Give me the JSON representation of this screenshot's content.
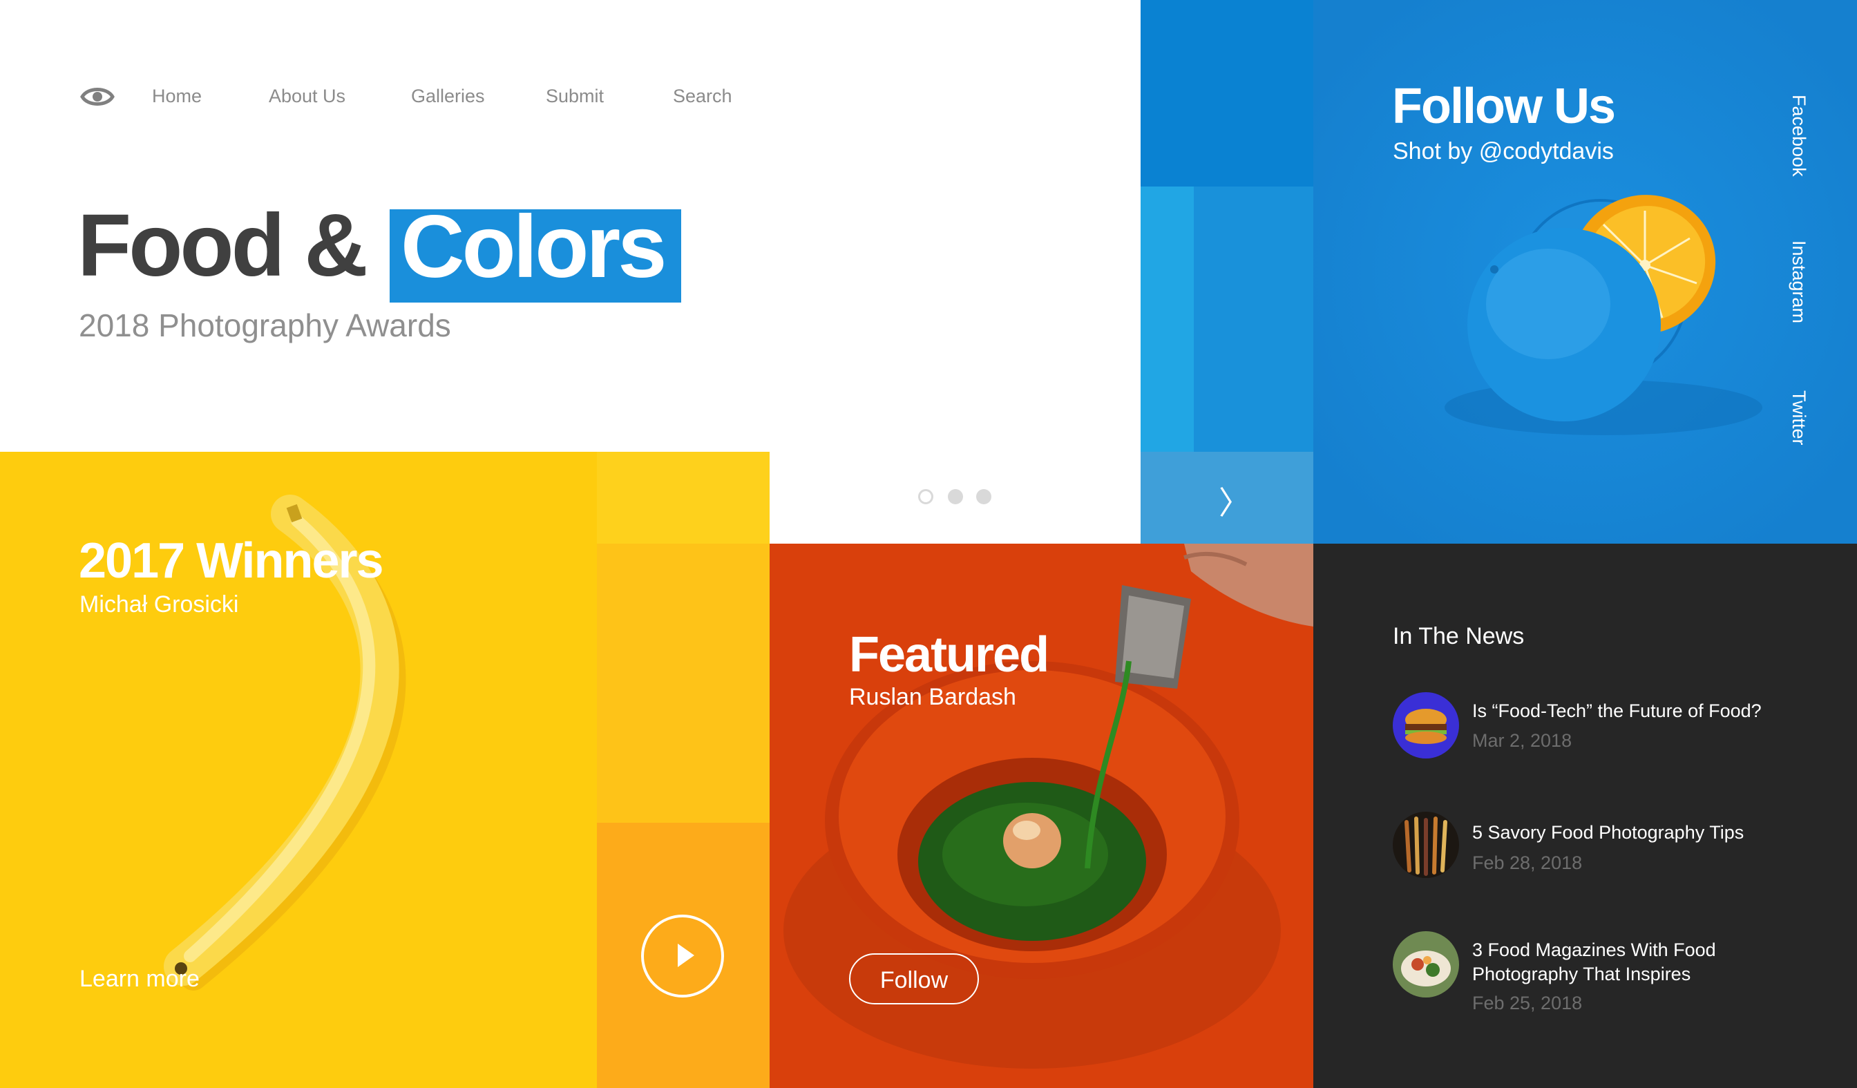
{
  "nav": {
    "items": [
      {
        "label": "Home"
      },
      {
        "label": "About Us"
      },
      {
        "label": "Galleries"
      },
      {
        "label": "Submit"
      },
      {
        "label": "Search"
      }
    ]
  },
  "hero": {
    "title_part1": "Food &",
    "title_part2": "Colors",
    "subtitle": "2018 Photography Awards"
  },
  "follow": {
    "title": "Follow Us",
    "subtitle": "Shot by @codytdavis",
    "social": [
      "Facebook",
      "Instagram",
      "Twitter"
    ],
    "next_glyph": "〉"
  },
  "carousel": {
    "dots": 3,
    "active_index": 0
  },
  "winners": {
    "title": "2017 Winners",
    "subtitle": "Michał Grosicki",
    "link": "Learn more"
  },
  "featured": {
    "title": "Featured",
    "subtitle": "Ruslan Bardash",
    "button": "Follow"
  },
  "news": {
    "heading": "In The News",
    "items": [
      {
        "title": "Is “Food-Tech” the Future of Food?",
        "date": "Mar 2, 2018"
      },
      {
        "title": "5 Savory Food Photography Tips",
        "date": "Feb 28, 2018"
      },
      {
        "title": "3 Food Magazines With Food Photography That Inspires",
        "date": "Feb 25, 2018"
      }
    ]
  },
  "colors": {
    "accent_blue": "#1a8fdb",
    "yellow": "#fecc0e",
    "orange_red": "#d9400c",
    "dark": "#262626"
  }
}
